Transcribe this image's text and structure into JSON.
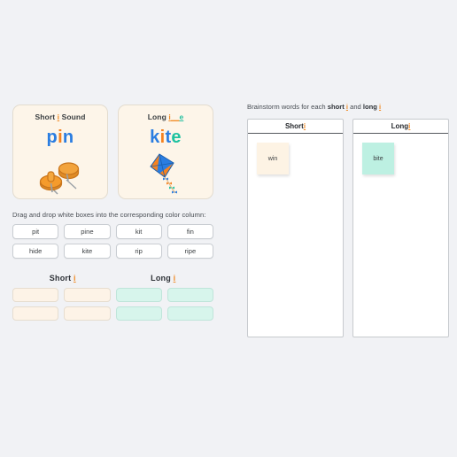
{
  "theme": {
    "background": "#f1f2f5",
    "orange": "#f58220",
    "blue": "#2a7de1",
    "teal": "#1fc2a0",
    "card_cream": "#fdf5e9",
    "drop_short": "#fdf3e7",
    "drop_long": "#d7f5ec",
    "sticky_short": "#fdf3e4",
    "sticky_long": "#bdf0e2"
  },
  "sound_cards": [
    {
      "title_prefix": "Short ",
      "title_vowel": "i",
      "title_suffix": " Sound",
      "word_parts": [
        {
          "text": "p",
          "color": "blue"
        },
        {
          "text": "i",
          "color": "orange"
        },
        {
          "text": "n",
          "color": "blue"
        }
      ],
      "word": "pin",
      "art": "pushpins-illustration"
    },
    {
      "title_prefix": "Long ",
      "title_vowel": "i",
      "title_blank": "__",
      "title_e": "e",
      "title_suffix": "",
      "word_parts": [
        {
          "text": "k",
          "color": "blue"
        },
        {
          "text": "i",
          "color": "orange"
        },
        {
          "text": "t",
          "color": "blue"
        },
        {
          "text": "e",
          "color": "teal"
        }
      ],
      "word": "kite",
      "art": "kite-illustration"
    }
  ],
  "drag_section": {
    "instruction": "Drag and drop white boxes into the corresponding color column:",
    "words": [
      "pit",
      "pine",
      "kit",
      "fin",
      "hide",
      "kite",
      "rip",
      "ripe"
    ],
    "columns": [
      {
        "label_prefix": "Short ",
        "label_vowel": "i",
        "type": "short"
      },
      {
        "label_prefix": "Long ",
        "label_vowel": "i",
        "type": "long"
      }
    ],
    "drop_cells": [
      {
        "type": "short",
        "value": ""
      },
      {
        "type": "short",
        "value": ""
      },
      {
        "type": "long",
        "value": ""
      },
      {
        "type": "long",
        "value": ""
      },
      {
        "type": "short",
        "value": ""
      },
      {
        "type": "short",
        "value": ""
      },
      {
        "type": "long",
        "value": ""
      },
      {
        "type": "long",
        "value": ""
      }
    ]
  },
  "brainstorm": {
    "instruction_start": "Brainstorm words for each ",
    "instruction_short": "short ",
    "instruction_short_vowel": "i",
    "instruction_mid": " and ",
    "instruction_long": "long ",
    "instruction_long_vowel": "i",
    "boards": [
      {
        "head_prefix": "Short ",
        "head_vowel": "i",
        "type": "short",
        "notes": [
          {
            "text": "win"
          }
        ]
      },
      {
        "head_prefix": "Long ",
        "head_vowel": "i",
        "type": "long",
        "notes": [
          {
            "text": "bite"
          }
        ]
      }
    ]
  }
}
